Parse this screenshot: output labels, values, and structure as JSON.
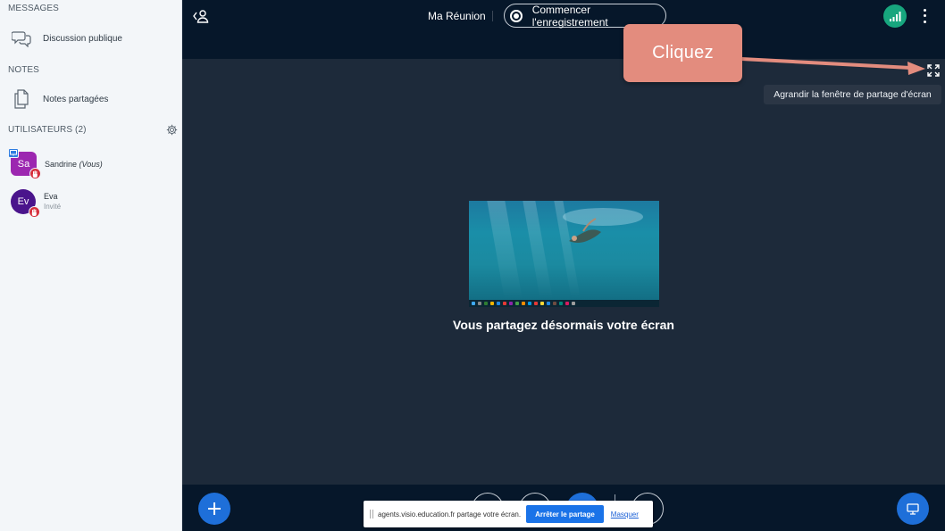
{
  "sidebar": {
    "messages_title": "MESSAGES",
    "public_chat": "Discussion publique",
    "notes_title": "NOTES",
    "shared_notes": "Notes partagées",
    "users_title": "UTILISATEURS (2)",
    "users": [
      {
        "initials": "Sa",
        "name": "Sandrine",
        "suffix": "(Vous)",
        "role": "",
        "color": "#9c27b0"
      },
      {
        "initials": "Ev",
        "name": "Eva",
        "suffix": "",
        "role": "Invité",
        "color": "#4a148c"
      }
    ]
  },
  "topbar": {
    "meeting_title": "Ma Réunion",
    "record_label": "Commencer l'enregistrement"
  },
  "main": {
    "share_message": "Vous partagez désormais votre écran",
    "tooltip": "Agrandir la fenêtre de partage d'écran"
  },
  "callout": {
    "text": "Cliquez"
  },
  "share_notice": {
    "text": "agents.visio.education.fr partage votre écran.",
    "stop_label": "Arrêter le partage",
    "hide_label": "Masquer"
  },
  "colors": {
    "primary_blue": "#1e6fd9",
    "callout": "#e38c7e",
    "signal_green": "#17a67e",
    "hand_red": "#d62f3c"
  }
}
